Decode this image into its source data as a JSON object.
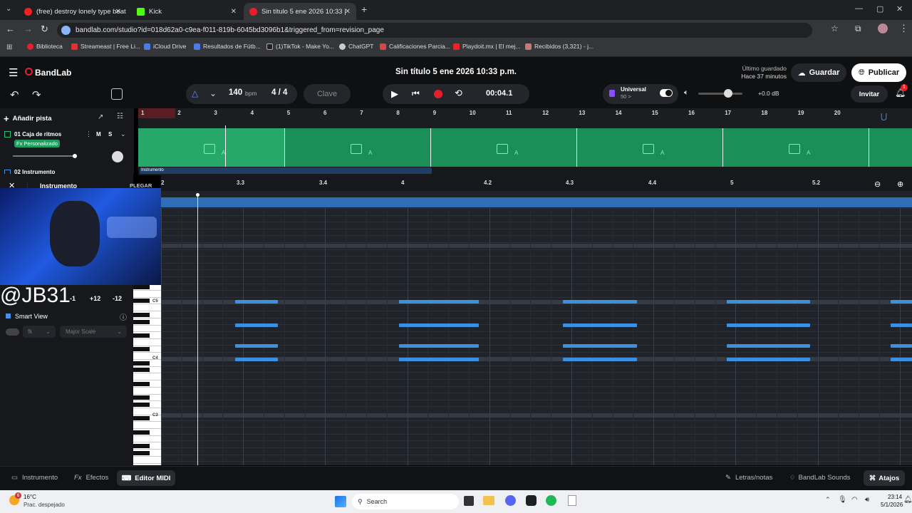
{
  "browser": {
    "tabs": [
      {
        "label": "(free) destroy lonely type beat -",
        "active": false
      },
      {
        "label": "Kick",
        "active": false
      },
      {
        "label": "Sin título 5 ene 2026 10:33 |",
        "active": true
      }
    ],
    "url": "bandlab.com/studio?id=018d62a0-c9ea-f011-819b-6045bd3096b1&triggered_from=revision_page",
    "bookmarks": [
      "Biblioteca",
      "Streameast | Free Li...",
      "iCloud Drive",
      "Resultados de Fútb...",
      "(1)TikTok - Make Yo...",
      "ChatGPT",
      "Calificaciones Parcia...",
      "Playdoit.mx | El mej...",
      "Recibidos (3,321) - j..."
    ]
  },
  "app": {
    "brand": "BandLab",
    "project_title": "Sin título 5 ene 2026 10:33 p.m.",
    "last_saved_label": "Último guardado",
    "last_saved_value": "Hace 37 minutos",
    "save_label": "Guardar",
    "publish_label": "Publicar",
    "invite_label": "Invitar",
    "notif_count": "1"
  },
  "toolbar": {
    "bpm_value": "140",
    "bpm_unit": "bpm",
    "time_sig": "4 / 4",
    "key_label": "Clave",
    "time": "00:04.1",
    "tuner_label": "Universal",
    "tuner_value": "50 >",
    "volume_db": "+0.0 dB"
  },
  "tracks": {
    "add_label": "Añadir pista",
    "items": [
      {
        "name": "01 Caja de ritmos",
        "fx": "Fx Personalizado",
        "m": "M",
        "s": "S"
      },
      {
        "name": "02 Instrumento"
      }
    ],
    "clip_letter": "A",
    "region_label": "Instrumento"
  },
  "ruler_top": [
    "1",
    "2",
    "3",
    "4",
    "5",
    "6",
    "7",
    "8",
    "9",
    "10",
    "11",
    "12",
    "13",
    "14",
    "15",
    "16",
    "17",
    "18",
    "19",
    "20"
  ],
  "midi_editor": {
    "title": "Instrumento",
    "collapse_label": "PLEGAR",
    "ruler": [
      "2",
      "3.3",
      "3.4",
      "4",
      "4.2",
      "4.3",
      "4.4",
      "5",
      "5.2"
    ],
    "transpose": [
      "-1",
      "+12",
      "-12"
    ],
    "smart_view": "Smart View",
    "key_select": "fk",
    "scale_select": "Major Scale",
    "piano_labels": [
      "C5",
      "C4",
      "C3"
    ],
    "overlay_handle": "@JB31"
  },
  "bottom": {
    "tabs": [
      "Instrumento",
      "Efectos",
      "Editor MIDI"
    ],
    "right": [
      "Letras/notas",
      "BandLab Sounds",
      "Atajos"
    ]
  },
  "taskbar": {
    "weather_temp": "16°C",
    "weather_desc": "Prac. despejado",
    "weather_badge": "6",
    "search": "Search",
    "time": "23:14",
    "date": "5/1/2026"
  },
  "colors": {
    "accent_green": "#1b8f57",
    "note_blue": "#3d8fe0",
    "record_red": "#e5202b"
  }
}
